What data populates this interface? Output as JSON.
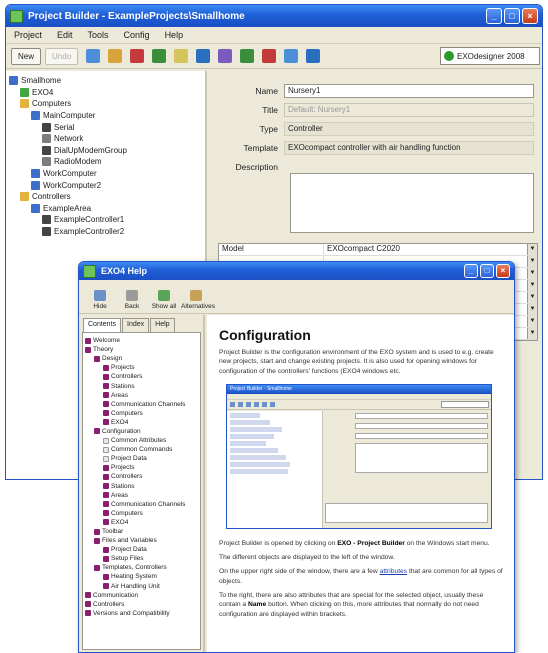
{
  "main_window": {
    "title": "Project Builder - ExampleProjects\\Smallhome",
    "menu": [
      "Project",
      "Edit",
      "Tools",
      "Config",
      "Help"
    ],
    "toolbar": {
      "new_label": "New",
      "disabled_label": "Undo"
    },
    "device_selector": "EXOdesigner 2008",
    "tree": [
      {
        "label": "Smallhome",
        "level": 0,
        "icon": "b"
      },
      {
        "label": "EXO4",
        "level": 1,
        "icon": "g"
      },
      {
        "label": "Computers",
        "level": 1,
        "icon": "y"
      },
      {
        "label": "MainComputer",
        "level": 2,
        "icon": "b"
      },
      {
        "label": "Serial",
        "level": 3,
        "icon": "k"
      },
      {
        "label": "Network",
        "level": 3,
        "icon": "t"
      },
      {
        "label": "DialUpModemGroup",
        "level": 3,
        "icon": "k"
      },
      {
        "label": "RadioModem",
        "level": 3,
        "icon": "t"
      },
      {
        "label": "WorkComputer",
        "level": 2,
        "icon": "b"
      },
      {
        "label": "WorkComputer2",
        "level": 2,
        "icon": "b"
      },
      {
        "label": "Controllers",
        "level": 1,
        "icon": "y"
      },
      {
        "label": "ExampleArea",
        "level": 2,
        "icon": "b"
      },
      {
        "label": "ExampleController1",
        "level": 3,
        "icon": "k"
      },
      {
        "label": "ExampleController2",
        "level": 3,
        "icon": "k"
      }
    ],
    "props": {
      "name_label": "Name",
      "name_value": "Nursery1",
      "title_label": "Title",
      "title_value": "Default: Nursery1",
      "type_label": "Type",
      "type_value": "Controller",
      "template_label": "Template",
      "template_value": "EXOcompact controller with air handling function",
      "description_label": "Description"
    },
    "table": [
      {
        "key": "Model",
        "value": "EXOcompact C2020"
      },
      {
        "key": "",
        "value": ""
      },
      {
        "key": "",
        "value": ""
      },
      {
        "key": "",
        "value": ""
      },
      {
        "key": "",
        "value": ""
      },
      {
        "key": "",
        "value": ""
      },
      {
        "key": "",
        "value": ""
      },
      {
        "key": "",
        "value": ""
      }
    ]
  },
  "help_window": {
    "title": "EXO4 Help",
    "toolbar": [
      "Hide",
      "Back",
      "Show all",
      "Alternatives"
    ],
    "tabs": [
      "Contents",
      "Index",
      "Help"
    ],
    "tree": [
      {
        "label": "Welcome",
        "level": 0,
        "icon": "bk"
      },
      {
        "label": "Theory",
        "level": 0,
        "icon": "bk"
      },
      {
        "label": "Design",
        "level": 1,
        "icon": "bk"
      },
      {
        "label": "Projects",
        "level": 2,
        "icon": "bk"
      },
      {
        "label": "Controllers",
        "level": 2,
        "icon": "bk"
      },
      {
        "label": "Stations",
        "level": 2,
        "icon": "bk"
      },
      {
        "label": "Areas",
        "level": 2,
        "icon": "bk"
      },
      {
        "label": "Communication Channels",
        "level": 2,
        "icon": "bk"
      },
      {
        "label": "Computers",
        "level": 2,
        "icon": "bk"
      },
      {
        "label": "EXO4",
        "level": 2,
        "icon": "bk"
      },
      {
        "label": "Configuration",
        "level": 1,
        "icon": "bk"
      },
      {
        "label": "Common Attributes",
        "level": 2,
        "icon": "pg"
      },
      {
        "label": "Common Commands",
        "level": 2,
        "icon": "pg"
      },
      {
        "label": "Project Data",
        "level": 2,
        "icon": "pg"
      },
      {
        "label": "Projects",
        "level": 2,
        "icon": "bk"
      },
      {
        "label": "Controllers",
        "level": 2,
        "icon": "bk"
      },
      {
        "label": "Stations",
        "level": 2,
        "icon": "bk"
      },
      {
        "label": "Areas",
        "level": 2,
        "icon": "bk"
      },
      {
        "label": "Communication Channels",
        "level": 2,
        "icon": "bk"
      },
      {
        "label": "Computers",
        "level": 2,
        "icon": "bk"
      },
      {
        "label": "EXO4",
        "level": 2,
        "icon": "bk"
      },
      {
        "label": "Toolbar",
        "level": 1,
        "icon": "bk"
      },
      {
        "label": "Files and Variables",
        "level": 1,
        "icon": "bk"
      },
      {
        "label": "Project Data",
        "level": 2,
        "icon": "bk"
      },
      {
        "label": "Setup Files",
        "level": 2,
        "icon": "bk"
      },
      {
        "label": "Templates, Controllers",
        "level": 1,
        "icon": "bk"
      },
      {
        "label": "Heating System",
        "level": 2,
        "icon": "bk"
      },
      {
        "label": "Air Handling Unit",
        "level": 2,
        "icon": "bk"
      },
      {
        "label": "Communication",
        "level": 0,
        "icon": "bk"
      },
      {
        "label": "Controllers",
        "level": 0,
        "icon": "bk"
      },
      {
        "label": "Versions and Compatibility",
        "level": 0,
        "icon": "bk"
      }
    ],
    "content": {
      "heading": "Configuration",
      "p1": "Project Builder is the configuration environment of the EXO system and is used to e.g. create new projects, start and change existing projects. It is also used for opening windows for configuration of the controllers' functions (EXO4 windows etc.",
      "p2_a": "Project Builder is opened by clicking on ",
      "p2_b": "EXO - Project Builder",
      "p2_c": " on the Windows start menu.",
      "p3": "The different objects are displayed to the left of the window.",
      "p4_a": "On the upper right side of the window, there are a few ",
      "p4_link": "attributes",
      "p4_c": " that are common for all types of objects.",
      "p5_a": "To the right, there are also attributes that are special for the selected object, usually these contain a ",
      "p5_b": "Name",
      "p5_c": " button. When clicking on this, more attributes that normally do not need configuration are displayed within brackets."
    },
    "screenshot_title": "Project Builder - Smallhome"
  }
}
